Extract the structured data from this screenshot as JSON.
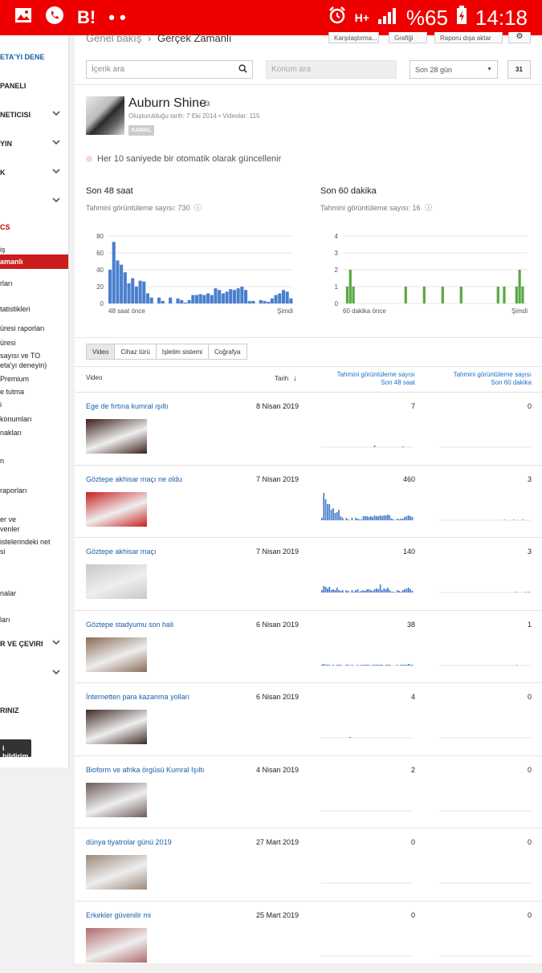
{
  "status_bar": {
    "carrier_icon": "B!",
    "dots": "• •",
    "network": "H+",
    "battery": "%65",
    "time": "14:18",
    "colors": {
      "bar": "#ee0000"
    }
  },
  "sidebar": {
    "items": [
      {
        "label": "ETA'YI DENE",
        "style": "blue"
      },
      {
        "label": "PANELI",
        "style": "bold"
      },
      {
        "label": "NETICISI",
        "style": "bold",
        "chevron": true
      },
      {
        "label": "YIN",
        "style": "bold",
        "chevron": true
      },
      {
        "label": "K",
        "style": "bold",
        "chevron": true
      },
      {
        "label": "",
        "style": "bold",
        "chevron": true
      },
      {
        "label": "CS",
        "style": "red"
      },
      {
        "label": "iş",
        "style": "plain"
      },
      {
        "label": "amanlı",
        "style": "active"
      },
      {
        "label": "rları",
        "style": "plain"
      },
      {
        "label": "tatistikleri",
        "style": "plain"
      },
      {
        "label": "üresi raporları",
        "style": "plain"
      },
      {
        "label": "üresi",
        "style": "plain"
      },
      {
        "label": "sayısı ve TO",
        "style": "plain"
      },
      {
        "label": "eta'yı deneyin)",
        "style": "plain"
      },
      {
        "label": "Premium",
        "style": "plain"
      },
      {
        "label": "e tutma",
        "style": "plain"
      },
      {
        "label": "i",
        "style": "plain"
      },
      {
        "label": "konumları",
        "style": "plain"
      },
      {
        "label": "nakları",
        "style": "plain"
      },
      {
        "label": "n",
        "style": "plain"
      },
      {
        "label": "raporları",
        "style": "plain"
      },
      {
        "label": "er ve",
        "style": "plain"
      },
      {
        "label": "venler",
        "style": "plain"
      },
      {
        "label": "istelerindeki net",
        "style": "plain"
      },
      {
        "label": "si",
        "style": "plain"
      },
      {
        "label": "nalar",
        "style": "plain"
      },
      {
        "label": "ları",
        "style": "plain"
      },
      {
        "label": "R VE ÇEVIRI",
        "style": "bold",
        "chevron": true
      },
      {
        "label": "",
        "style": "bold",
        "chevron": true
      },
      {
        "label": "RINIZ",
        "style": "bold"
      }
    ],
    "notify_button": "i bildirim"
  },
  "header": {
    "crumb_parent": "Genel bakış",
    "crumb_current": "Gerçek Zamanlı",
    "buttons": [
      "Karşılaştırma...",
      "Grafiği",
      "Raporu dışa aktar"
    ]
  },
  "filters": {
    "search_placeholder": "İçerik ara",
    "location_placeholder": "Konum ara",
    "date_range": "Son 28 gün",
    "calendar_label": "31"
  },
  "channel": {
    "name": "Auburn Shine",
    "meta": "Oluşturulduğu tarih: 7 Eki 2014  •  Videolar: 115",
    "badge": "KANAL",
    "update_note": "Her 10 saniyede bir otomatik olarak güncellenir"
  },
  "stats": {
    "left": {
      "title": "Son 48 saat",
      "sub": "Tahmini görüntüleme sayısı: 730",
      "x_start": "48 saat önce",
      "x_end": "Şimdi"
    },
    "right": {
      "title": "Son 60 dakika",
      "sub": "Tahmini görüntüleme sayısı: 16",
      "x_start": "60 dakika önce",
      "x_end": "Şimdi"
    }
  },
  "chart_data": [
    {
      "type": "bar",
      "title": "Son 48 saat",
      "xlabel": "",
      "ylabel": "",
      "x_tick_labels": [
        "48 saat önce",
        "Şimdi"
      ],
      "y_ticks": [
        0,
        20,
        40,
        60,
        80
      ],
      "ylim": [
        0,
        80
      ],
      "color": "#4a7fce",
      "values": [
        40,
        73,
        51,
        46,
        37,
        24,
        30,
        20,
        27,
        26,
        12,
        7,
        0,
        7,
        3,
        0,
        7,
        0,
        6,
        4,
        1,
        4,
        10,
        10,
        11,
        10,
        12,
        10,
        18,
        16,
        12,
        14,
        17,
        16,
        18,
        20,
        16,
        3,
        3,
        0,
        4,
        3,
        2,
        6,
        10,
        12,
        16,
        14,
        6
      ]
    },
    {
      "type": "bar",
      "title": "Son 60 dakika",
      "xlabel": "",
      "ylabel": "",
      "x_tick_labels": [
        "60 dakika önce",
        "Şimdi"
      ],
      "y_ticks": [
        0,
        1,
        2,
        3,
        4
      ],
      "ylim": [
        0,
        4
      ],
      "color": "#5aa844",
      "values": [
        0,
        1,
        2,
        1,
        0,
        0,
        0,
        0,
        0,
        0,
        0,
        0,
        0,
        0,
        0,
        0,
        0,
        0,
        0,
        0,
        1,
        0,
        0,
        0,
        0,
        0,
        1,
        0,
        0,
        0,
        0,
        0,
        1,
        0,
        0,
        0,
        0,
        0,
        1,
        0,
        0,
        0,
        0,
        0,
        0,
        0,
        0,
        0,
        0,
        0,
        1,
        0,
        1,
        0,
        0,
        0,
        1,
        2,
        1,
        0
      ]
    }
  ],
  "tabs": [
    "Video",
    "Cihaz türü",
    "İşletim sistemi",
    "Coğrafya"
  ],
  "table": {
    "col_video": "Video",
    "col_date": "Tarih",
    "col_48_line1": "Tahmini görüntüleme sayısı",
    "col_48_line2": "Son 48 saat",
    "col_60_line1": "Tahmini görüntüleme sayısı",
    "col_60_line2": "Son 60 dakika",
    "rows": [
      {
        "title": "Ege de fırtına kumral ışıltı",
        "date": "8 Nisan 2019",
        "v48": "7",
        "v60": "0",
        "spark48": [
          0,
          0,
          0,
          0,
          0,
          0,
          0,
          0,
          0,
          0,
          0,
          0,
          0,
          0,
          0,
          0,
          0,
          0,
          0,
          0,
          0,
          0,
          0,
          0,
          0,
          0,
          0,
          0,
          2,
          0,
          0,
          0,
          0,
          0,
          0,
          0,
          0,
          0,
          0,
          0,
          0,
          0,
          0,
          1,
          0,
          0,
          0,
          0,
          0
        ],
        "spark60": [],
        "thumb": "#3a1e1a"
      },
      {
        "title": "Göztepe akhisar maçı ne oldu",
        "date": "7 Nisan 2019",
        "v48": "460",
        "v60": "3",
        "spark48": [
          3,
          34,
          26,
          20,
          20,
          13,
          15,
          9,
          10,
          13,
          5,
          3,
          0,
          3,
          1,
          0,
          3,
          0,
          3,
          2,
          1,
          1,
          5,
          5,
          5,
          4,
          5,
          4,
          6,
          5,
          5,
          6,
          5,
          6,
          6,
          7,
          6,
          2,
          1,
          0,
          2,
          1,
          2,
          2,
          4,
          5,
          6,
          5,
          4
        ],
        "spark60": [
          0,
          0,
          0,
          0,
          0,
          0,
          0,
          0,
          0,
          0,
          0,
          0,
          0,
          0,
          0,
          0,
          0,
          0,
          0,
          0,
          0,
          0,
          0,
          0,
          0,
          0,
          0,
          0,
          0,
          0,
          0,
          0,
          0,
          0,
          0,
          0,
          0,
          0,
          0,
          0,
          0,
          0,
          1,
          0,
          0,
          0,
          0,
          0,
          1,
          0,
          0,
          0,
          0,
          0,
          1,
          0,
          0,
          0,
          0,
          0
        ],
        "thumb": "#c82020"
      },
      {
        "title": "Göztepe akhisar maçı",
        "date": "7 Nisan 2019",
        "v48": "140",
        "v60": "3",
        "spark48": [
          3,
          8,
          7,
          5,
          7,
          3,
          4,
          3,
          6,
          3,
          2,
          3,
          0,
          3,
          2,
          0,
          3,
          1,
          3,
          4,
          1,
          2,
          3,
          2,
          4,
          4,
          3,
          2,
          4,
          5,
          4,
          10,
          3,
          5,
          4,
          6,
          3,
          1,
          1,
          0,
          3,
          2,
          1,
          3,
          4,
          5,
          6,
          4,
          2
        ],
        "spark60": [
          0,
          0,
          0,
          0,
          0,
          0,
          0,
          0,
          0,
          0,
          0,
          0,
          0,
          0,
          0,
          0,
          0,
          0,
          0,
          0,
          0,
          0,
          0,
          0,
          0,
          0,
          0,
          0,
          0,
          0,
          0,
          0,
          0,
          0,
          0,
          0,
          0,
          0,
          0,
          0,
          0,
          0,
          0,
          0,
          0,
          0,
          0,
          0,
          0,
          0,
          1,
          0,
          0,
          0,
          0,
          0,
          1,
          0,
          1,
          0
        ],
        "thumb": "#c8c8c8"
      },
      {
        "title": "Göztepe stadyumu son hali",
        "date": "6 Nisan 2019",
        "v48": "38",
        "v60": "1",
        "spark48": [
          1,
          2,
          1,
          1,
          1,
          0,
          1,
          0,
          1,
          1,
          1,
          0,
          0,
          1,
          1,
          0,
          1,
          0,
          0,
          1,
          0,
          1,
          1,
          1,
          1,
          1,
          0,
          1,
          1,
          1,
          1,
          1,
          1,
          0,
          1,
          1,
          1,
          0,
          0,
          0,
          1,
          0,
          1,
          1,
          1,
          1,
          2,
          1,
          1
        ],
        "spark60": [
          0,
          0,
          0,
          0,
          0,
          0,
          0,
          0,
          0,
          0,
          0,
          0,
          0,
          0,
          0,
          0,
          0,
          0,
          0,
          0,
          0,
          0,
          0,
          0,
          0,
          0,
          0,
          0,
          0,
          0,
          0,
          0,
          0,
          0,
          0,
          0,
          0,
          0,
          0,
          0,
          0,
          0,
          0,
          0,
          0,
          0,
          0,
          0,
          0,
          0,
          1,
          0,
          0,
          0,
          0,
          0,
          0,
          0,
          0,
          0
        ],
        "thumb": "#8a6a55"
      },
      {
        "title": "İnternetten para kazanma yolları",
        "date": "6 Nisan 2019",
        "v48": "4",
        "v60": "0",
        "spark48": [
          0,
          0,
          0,
          0,
          0,
          0,
          0,
          0,
          0,
          0,
          0,
          0,
          0,
          0,
          0,
          1,
          0,
          0,
          0,
          0,
          0,
          0,
          0,
          0,
          0,
          0,
          0,
          0,
          0,
          0,
          0,
          0,
          0,
          0,
          0,
          0,
          0,
          0,
          0,
          0,
          0,
          0,
          0,
          0,
          0,
          0,
          0,
          0,
          0
        ],
        "spark60": [],
        "thumb": "#3e2a26"
      },
      {
        "title": "Bioform ve afrika örgüsü Kumral Işıltı",
        "date": "4 Nisan 2019",
        "v48": "2",
        "v60": "0",
        "spark48": [
          0,
          0,
          0,
          0,
          0,
          0,
          0,
          0,
          0,
          0,
          0,
          0,
          0,
          0,
          0,
          0,
          0,
          0,
          0,
          0,
          0,
          0,
          0,
          0,
          0,
          0,
          0,
          0,
          0,
          0,
          0,
          0,
          0,
          0,
          0,
          0,
          0,
          0,
          0,
          0,
          0,
          0,
          0,
          0,
          0,
          0,
          0,
          0,
          0
        ],
        "spark60": [],
        "thumb": "#6d5a5a"
      },
      {
        "title": "dünya tiyatrolar günü 2019",
        "date": "27 Mart 2019",
        "v48": "0",
        "v60": "0",
        "spark48": [],
        "spark60": [],
        "thumb": "#9c8a7a"
      },
      {
        "title": "Erkekler güvenilir mi",
        "date": "25 Mart 2019",
        "v48": "0",
        "v60": "0",
        "spark48": [],
        "spark60": [],
        "thumb": "#b06a6a"
      }
    ]
  }
}
